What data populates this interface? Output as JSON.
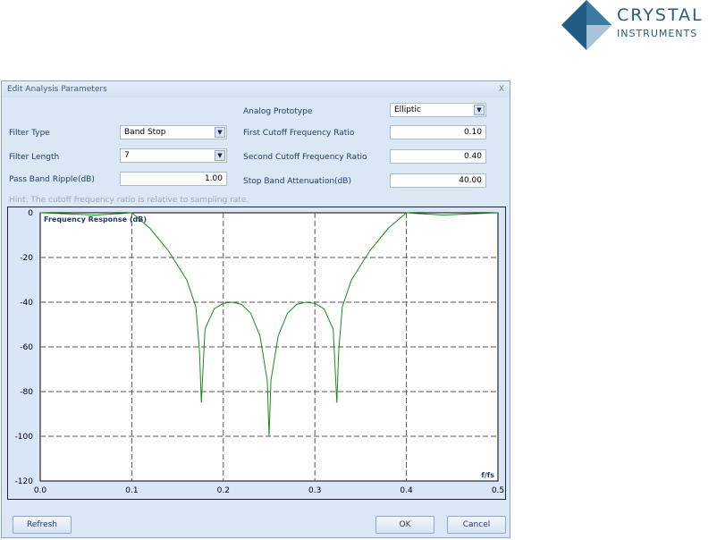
{
  "logo": {
    "line1": "CRYSTAL",
    "line2": "INSTRUMENTS"
  },
  "dialog": {
    "title": "Edit Analysis Parameters",
    "close": "X"
  },
  "form": {
    "filter_type_label": "Filter Type",
    "filter_type": "Band Stop",
    "filter_length_label": "Filter Length",
    "filter_length": "7",
    "ripple_label": "Pass Band Ripple(dB)",
    "ripple": "1.00",
    "prototype_label": "Analog Prototype",
    "prototype": "Elliptic",
    "first_cutoff_label": "First Cutoff Frequency Ratio",
    "first_cutoff": "0.10",
    "second_cutoff_label": "Second Cutoff Frequency Ratio",
    "second_cutoff": "0.40",
    "attenuation_label": "Stop Band Attenuation(dB)",
    "attenuation": "40.00",
    "hint": "Hint: The cutoff frequency ratio is relative to sampling rate."
  },
  "buttons": {
    "refresh": "Refresh",
    "ok": "OK",
    "cancel": "Cancel"
  },
  "chart_data": {
    "type": "line",
    "title": "Frequency Response (dB)",
    "xlabel": "f/fs",
    "ylabel": "",
    "xlim": [
      0,
      0.5
    ],
    "ylim": [
      -120,
      0
    ],
    "grid": true,
    "xticks": [
      "0.0",
      "0.1",
      "0.2",
      "0.3",
      "0.4",
      "0.5"
    ],
    "yticks": [
      "0",
      "-20",
      "-40",
      "-60",
      "-80",
      "-100",
      "-120"
    ],
    "color": "#1a8a1a",
    "x": [
      0,
      0.03,
      0.06,
      0.09,
      0.1,
      0.12,
      0.14,
      0.16,
      0.17,
      0.174,
      0.176,
      0.18,
      0.19,
      0.2,
      0.21,
      0.22,
      0.23,
      0.24,
      0.248,
      0.25,
      0.252,
      0.26,
      0.27,
      0.28,
      0.29,
      0.3,
      0.31,
      0.32,
      0.324,
      0.326,
      0.33,
      0.34,
      0.36,
      0.38,
      0.4,
      0.41,
      0.44,
      0.47,
      0.5
    ],
    "y": [
      0,
      -0.5,
      -1,
      -0.3,
      0,
      -7,
      -17,
      -30,
      -42,
      -62,
      -85,
      -52,
      -43,
      -40.5,
      -40,
      -41,
      -45,
      -55,
      -75,
      -100,
      -75,
      -55,
      -45,
      -41,
      -40,
      -40.5,
      -43,
      -52,
      -85,
      -62,
      -42,
      -30,
      -17,
      -7,
      0,
      -0.3,
      -1,
      -0.5,
      0
    ]
  }
}
